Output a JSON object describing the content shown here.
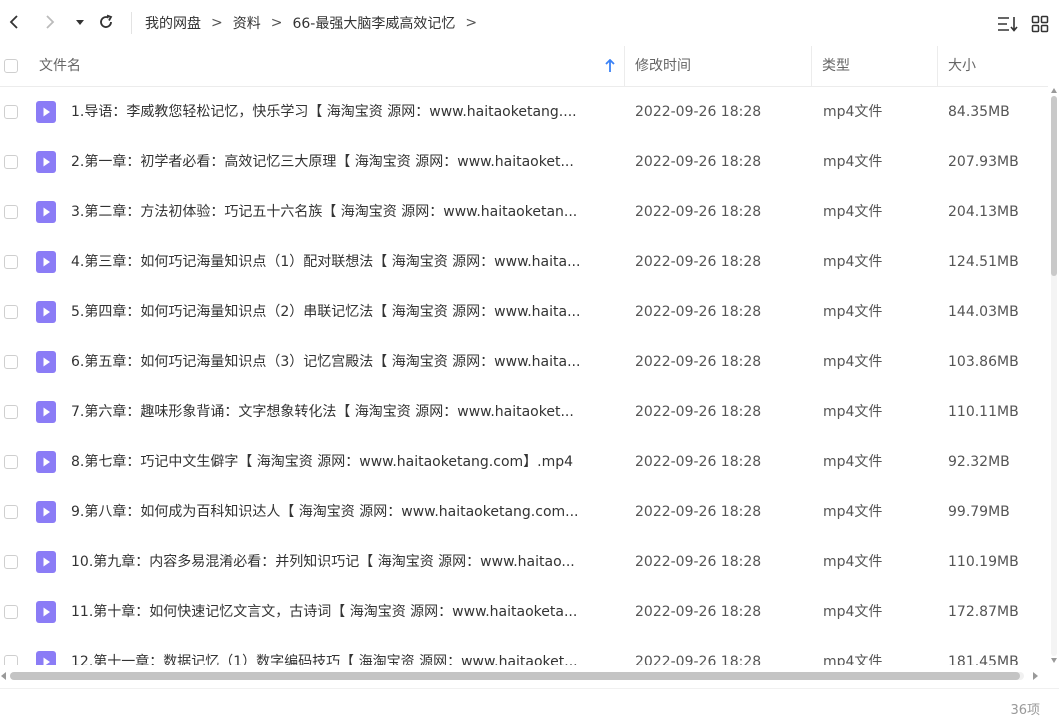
{
  "breadcrumb": [
    "我的网盘",
    "资料",
    "66-最强大脑李威高效记忆"
  ],
  "breadcrumb_separator": ">",
  "columns": {
    "name": "文件名",
    "modified": "修改时间",
    "type": "类型",
    "size": "大小"
  },
  "sort": {
    "column": "name",
    "direction": "ascending"
  },
  "colors": {
    "file_icon": "#8b7cf6",
    "scroll_thumb": "#c4c4c4",
    "text": "#333333"
  },
  "files": [
    {
      "name": "1.导语：李威教您轻松记忆，快乐学习【 海淘宝资 源网：www.haitaoketang....",
      "modified": "2022-09-26 18:28",
      "type": "mp4文件",
      "size": "84.35MB"
    },
    {
      "name": "2.第一章：初学者必看：高效记忆三大原理【 海淘宝资 源网：www.haitaoket...",
      "modified": "2022-09-26 18:28",
      "type": "mp4文件",
      "size": "207.93MB"
    },
    {
      "name": "3.第二章：方法初体验：巧记五十六名族【 海淘宝资 源网：www.haitaoketan...",
      "modified": "2022-09-26 18:28",
      "type": "mp4文件",
      "size": "204.13MB"
    },
    {
      "name": "4.第三章：如何巧记海量知识点（1）配对联想法【 海淘宝资 源网：www.haita...",
      "modified": "2022-09-26 18:28",
      "type": "mp4文件",
      "size": "124.51MB"
    },
    {
      "name": "5.第四章：如何巧记海量知识点（2）串联记忆法【 海淘宝资 源网：www.haita...",
      "modified": "2022-09-26 18:28",
      "type": "mp4文件",
      "size": "144.03MB"
    },
    {
      "name": "6.第五章：如何巧记海量知识点（3）记忆宫殿法【 海淘宝资 源网：www.haita...",
      "modified": "2022-09-26 18:28",
      "type": "mp4文件",
      "size": "103.86MB"
    },
    {
      "name": "7.第六章：趣味形象背诵：文字想象转化法【 海淘宝资 源网：www.haitaoket...",
      "modified": "2022-09-26 18:28",
      "type": "mp4文件",
      "size": "110.11MB"
    },
    {
      "name": "8.第七章：巧记中文生僻字【 海淘宝资 源网：www.haitaoketang.com】.mp4",
      "modified": "2022-09-26 18:28",
      "type": "mp4文件",
      "size": "92.32MB"
    },
    {
      "name": "9.第八章：如何成为百科知识达人【 海淘宝资 源网：www.haitaoketang.com...",
      "modified": "2022-09-26 18:28",
      "type": "mp4文件",
      "size": "99.79MB"
    },
    {
      "name": "10.第九章：内容多易混淆必看：并列知识巧记【 海淘宝资 源网：www.haitao...",
      "modified": "2022-09-26 18:28",
      "type": "mp4文件",
      "size": "110.19MB"
    },
    {
      "name": "11.第十章：如何快速记忆文言文，古诗词【 海淘宝资 源网：www.haitaoketa...",
      "modified": "2022-09-26 18:28",
      "type": "mp4文件",
      "size": "172.87MB"
    },
    {
      "name": "12.第十一章：数据记忆（1）数字编码技巧【 海淘宝资 源网：www.haitaoket...",
      "modified": "2022-09-26 18:28",
      "type": "mp4文件",
      "size": "181.45MB"
    }
  ],
  "footer": {
    "item_count": "36项"
  }
}
